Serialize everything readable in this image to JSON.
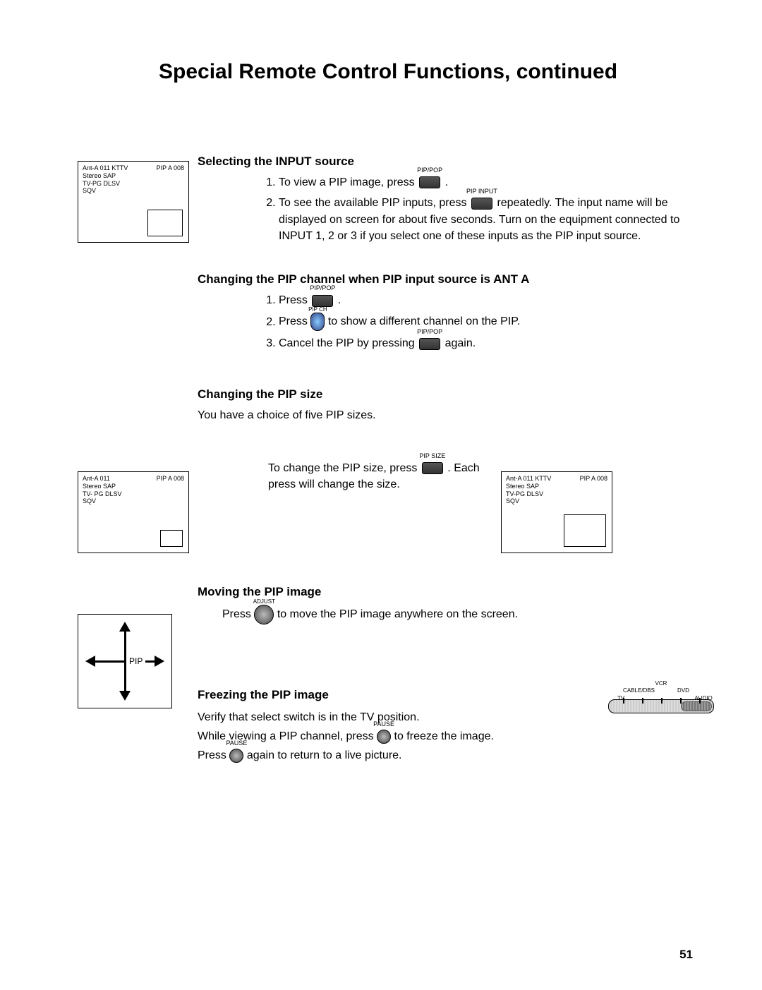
{
  "title": "Special Remote Control Functions, continued",
  "page_number": "51",
  "sections": {
    "s1": {
      "heading": "Selecting the INPUT source",
      "step1_a": "To view a PIP image, press",
      "step1_b": ".",
      "btn1_label": "PIP/POP",
      "step2_a": "To see the available PIP inputs, press",
      "step2_b": "repeatedly. The input name will be displayed on screen for about five seconds. Turn on the equipment connected to INPUT 1, 2 or 3 if you select one of these inputs as the PIP input source.",
      "btn2_label": "PIP INPUT",
      "tvbox": {
        "line1": "Ant-A 011 KTTV",
        "line2": "Stereo SAP",
        "line3": "TV-PG DLSV",
        "line4": "SQV",
        "corner": "PIP A 008"
      }
    },
    "s2": {
      "heading": "Changing the PIP channel when PIP input source is ANT A",
      "step1_a": "Press",
      "step1_b": ".",
      "btn1_label": "PIP/POP",
      "step2_a": "Press",
      "step2_b": "to show a different channel on the PIP.",
      "btn2_label": "PIP CH",
      "step3_a": "Cancel the PIP by pressing",
      "step3_b": "again.",
      "btn3_label": "PIP/POP"
    },
    "s3": {
      "heading": "Changing the PIP size",
      "intro": "You have a choice of five PIP sizes.",
      "text_a": "To change the PIP size, press",
      "text_b": ".",
      "text_c": "Each press will change the size.",
      "btn_label": "PIP SIZE",
      "tvbox_left": {
        "line1": "Ant-A 011",
        "line2": "Stereo SAP",
        "line3": "TV- PG DLSV",
        "line4": "SQV",
        "corner": "PIP A 008"
      },
      "tvbox_right": {
        "line1": "Ant-A 011 KTTV",
        "line2": "Stereo SAP",
        "line3": "TV-PG DLSV",
        "line4": "SQV",
        "corner": "PIP A 008"
      }
    },
    "s4": {
      "heading": "Moving the PIP image",
      "text_a": "Press",
      "text_b": "to move the PIP image anywhere on the screen.",
      "btn_label": "ADJUST",
      "diag_label": "PIP"
    },
    "s5": {
      "heading": "Freezing the PIP image",
      "line1": "Verify that select switch is in the TV position.",
      "line2_a": "While viewing a PIP channel, press",
      "line2_b": "to freeze the image.",
      "btn_label": "PAUSE",
      "line3_a": "Press",
      "line3_b": "again to return to a live picture.",
      "switch": {
        "pos1": "TV",
        "pos2": "CABLE/DBS",
        "pos3": "VCR",
        "pos4": "DVD",
        "pos5": "AUDIO"
      }
    }
  }
}
